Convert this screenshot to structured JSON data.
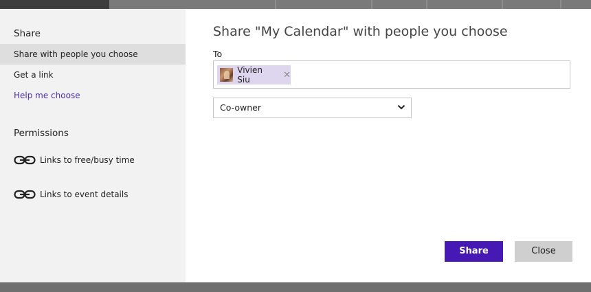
{
  "sidebar": {
    "share_heading": "Share",
    "items": [
      {
        "label": "Share with people you choose",
        "selected": true
      },
      {
        "label": "Get a link",
        "selected": false
      }
    ],
    "help_link": "Help me choose",
    "permissions_heading": "Permissions",
    "permissions": [
      {
        "label": "Links to free/busy time",
        "icon": "link-icon"
      },
      {
        "label": "Links to event details",
        "icon": "link-icon"
      }
    ]
  },
  "main": {
    "title": "Share \"My Calendar\" with people you choose",
    "to_label": "To",
    "recipient": {
      "name": "Vivien Siu",
      "remove_glyph": "✕"
    },
    "permission_select": {
      "selected": "Co-owner"
    }
  },
  "buttons": {
    "share": "Share",
    "close": "Close"
  },
  "colors": {
    "accent": "#4618b4",
    "link": "#4b2fa8",
    "chip_bg": "#ddd6ee",
    "sidebar_bg": "#f2f2f2",
    "selected_bg": "#dedede"
  }
}
